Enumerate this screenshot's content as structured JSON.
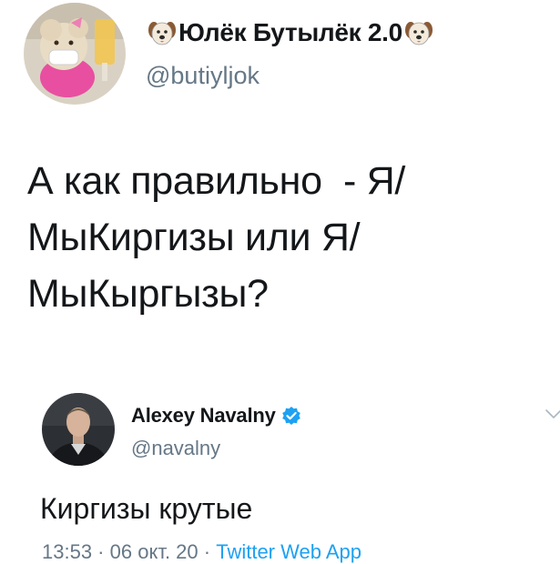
{
  "top_tweet": {
    "display_name": "Юлёк Бутылёк 2.0",
    "handle": "@butiyljok",
    "name_prefix_icon": "dog-face-emoji",
    "name_suffix_icon": "dog-face-emoji",
    "text": "А как правильно  - Я/\nМыКиргизы или Я/\nМыКыргызы?"
  },
  "quoted_tweet": {
    "display_name": "Alexey Navalny",
    "handle": "@navalny",
    "verified_icon": "verified-badge-icon",
    "more_icon": "chevron-down-icon",
    "text": "Киргизы крутые",
    "time": "13:53",
    "separator": " · ",
    "date": "06 окт. 20",
    "source": "Twitter Web App"
  },
  "colors": {
    "text": "#14171a",
    "secondary_text": "#657786",
    "accent": "#1da1f2"
  }
}
